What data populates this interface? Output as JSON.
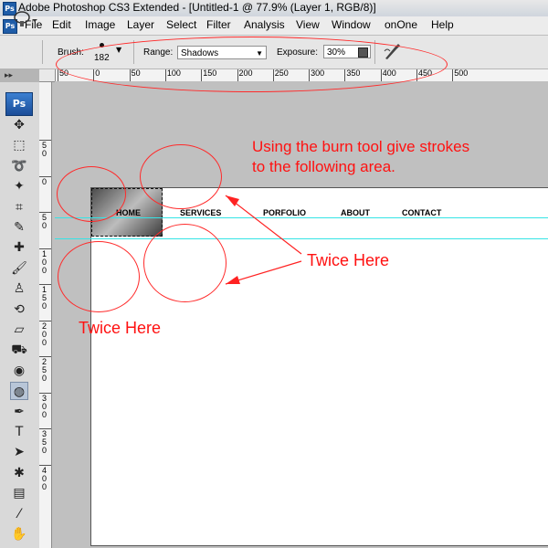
{
  "window": {
    "title": "Adobe Photoshop CS3 Extended - [Untitled-1 @ 77.9% (Layer 1, RGB/8)]",
    "app_icon": "Ps"
  },
  "menu": {
    "items": [
      "File",
      "Edit",
      "Image",
      "Layer",
      "Select",
      "Filter",
      "Analysis",
      "View",
      "Window",
      "onOne",
      "Help"
    ]
  },
  "options_bar": {
    "tool_icon": "burn-tool-icon",
    "brush_label": "Brush:",
    "brush_size": "182",
    "range_label": "Range:",
    "range_value": "Shadows",
    "exposure_label": "Exposure:",
    "exposure_value": "30%",
    "airbrush_icon": "airbrush-icon"
  },
  "ruler": {
    "top_labels": [
      "50",
      "0",
      "50",
      "100",
      "150",
      "200",
      "250",
      "300",
      "350",
      "400",
      "450",
      "500"
    ],
    "left_labels": [
      "5\n0",
      "0",
      "5\n0",
      "1\n0\n0",
      "1\n5\n0",
      "2\n0\n0",
      "2\n5\n0",
      "3\n0\n0",
      "3\n5\n0",
      "4\n0\n0"
    ]
  },
  "toolbox": {
    "logo": "Ps",
    "handle": "▸▸",
    "tools": [
      {
        "name": "move-tool-icon",
        "glyph": "✥"
      },
      {
        "name": "marquee-tool-icon",
        "glyph": "⬚"
      },
      {
        "name": "lasso-tool-icon",
        "glyph": "➰"
      },
      {
        "name": "magic-wand-tool-icon",
        "glyph": "✦"
      },
      {
        "name": "crop-tool-icon",
        "glyph": "⌗"
      },
      {
        "name": "slice-tool-icon",
        "glyph": "✎"
      },
      {
        "name": "healing-brush-tool-icon",
        "glyph": "✚"
      },
      {
        "name": "brush-tool-icon",
        "glyph": "🖌"
      },
      {
        "name": "clone-stamp-tool-icon",
        "glyph": "♙"
      },
      {
        "name": "history-brush-tool-icon",
        "glyph": "⟲"
      },
      {
        "name": "eraser-tool-icon",
        "glyph": "▱"
      },
      {
        "name": "paint-bucket-tool-icon",
        "glyph": "⛟"
      },
      {
        "name": "blur-tool-icon",
        "glyph": "◉"
      },
      {
        "name": "burn-tool-icon",
        "glyph": "◍"
      },
      {
        "name": "pen-tool-icon",
        "glyph": "✒"
      },
      {
        "name": "type-tool-icon",
        "glyph": "T"
      },
      {
        "name": "path-selection-tool-icon",
        "glyph": "➤"
      },
      {
        "name": "custom-shape-tool-icon",
        "glyph": "✱"
      },
      {
        "name": "notes-tool-icon",
        "glyph": "▤"
      },
      {
        "name": "eyedropper-tool-icon",
        "glyph": "⁄"
      },
      {
        "name": "hand-tool-icon",
        "glyph": "✋"
      }
    ],
    "active_tool": "burn-tool-icon"
  },
  "document": {
    "nav": [
      "HOME",
      "SERVICES",
      "PORFOLIO",
      "ABOUT",
      "CONTACT"
    ],
    "guide_color": "#35e4e6"
  },
  "annotations": {
    "instruction": "Using the burn tool give strokes\nto the following area.",
    "twice_right": "Twice Here",
    "twice_left": "Twice Here",
    "color": "#ff1111"
  }
}
